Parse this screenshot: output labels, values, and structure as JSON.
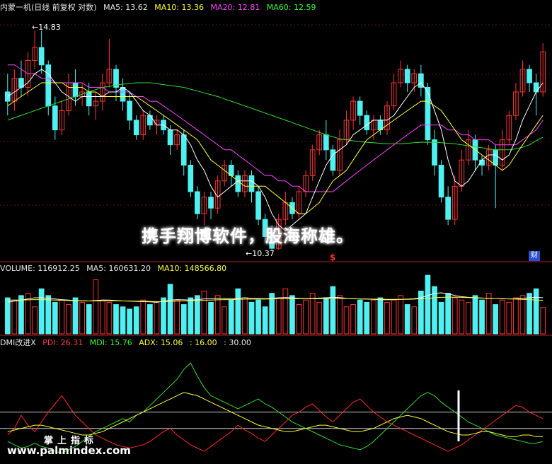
{
  "price_panel": {
    "title": "内蒙一机(日线 前复权 对数)",
    "ma5": "MA5: 13.62",
    "ma10": "MA10: 13.36",
    "ma20": "MA20: 12.81",
    "ma60": "MA60: 12.59",
    "high_label": "←14.83",
    "low_label": "←10.37",
    "slogan": "携手翔博软件，股海称雄。",
    "dollar_mark": "$",
    "cai_badge": "财"
  },
  "volume_panel": {
    "volume": "VOLUME: 116912.25",
    "ma5": "MA5: 160631.20",
    "ma10": "MA10: 148566.80"
  },
  "dmi_panel": {
    "name": "DMI改进X",
    "pdi": "PDI: 26.31",
    "mdi": "MDI: 15.76",
    "adx": "ADX: 15.06",
    "adxr": ": 16.00",
    "level": ": 30.00"
  },
  "watermark": {
    "line1": "掌上指标",
    "line2": "www.palmindex.com"
  },
  "colors": {
    "up": "#ff3333",
    "down": "#4ef0f0",
    "ma5": "#ffffff",
    "ma10": "#ffff33",
    "ma20": "#ff44ff",
    "ma60": "#33dd33"
  },
  "chart_data": {
    "type": "candlestick",
    "scale": "log",
    "ylim": [
      10.2,
      15.2
    ],
    "candles": [
      [
        13.4,
        13.2,
        13.8,
        12.9
      ],
      [
        13.2,
        13.7,
        13.9,
        13.0
      ],
      [
        13.7,
        13.5,
        14.1,
        13.3
      ],
      [
        13.5,
        14.1,
        14.3,
        13.3
      ],
      [
        14.1,
        14.4,
        14.8,
        13.9
      ],
      [
        14.4,
        14.0,
        14.8,
        13.8
      ],
      [
        14.0,
        13.1,
        14.1,
        12.9
      ],
      [
        13.1,
        12.6,
        13.3,
        12.4
      ],
      [
        12.6,
        13.0,
        13.2,
        12.5
      ],
      [
        13.0,
        13.6,
        13.8,
        12.9
      ],
      [
        13.6,
        13.3,
        13.9,
        13.1
      ],
      [
        13.3,
        13.4,
        13.6,
        13.1
      ],
      [
        13.4,
        13.1,
        13.6,
        12.9
      ],
      [
        13.1,
        13.2,
        13.4,
        12.8
      ],
      [
        13.2,
        13.6,
        13.8,
        13.0
      ],
      [
        13.6,
        13.9,
        14.6,
        13.5
      ],
      [
        13.9,
        13.5,
        14.0,
        13.2
      ],
      [
        13.5,
        13.2,
        13.7,
        13.0
      ],
      [
        13.2,
        12.8,
        13.4,
        12.6
      ],
      [
        12.8,
        12.5,
        12.9,
        12.4
      ],
      [
        12.5,
        12.9,
        13.0,
        12.4
      ],
      [
        12.9,
        12.7,
        13.0,
        12.6
      ],
      [
        12.7,
        12.8,
        12.9,
        12.5
      ],
      [
        12.8,
        12.6,
        12.9,
        12.5
      ],
      [
        12.6,
        12.3,
        12.7,
        12.1
      ],
      [
        12.3,
        12.5,
        12.6,
        12.2
      ],
      [
        12.5,
        11.9,
        12.6,
        11.7
      ],
      [
        11.9,
        11.4,
        12.0,
        11.3
      ],
      [
        11.4,
        11.0,
        11.5,
        10.9
      ],
      [
        11.0,
        11.3,
        11.4,
        10.8
      ],
      [
        11.3,
        11.1,
        11.4,
        10.9
      ],
      [
        11.1,
        11.6,
        11.7,
        11.0
      ],
      [
        11.6,
        11.9,
        12.0,
        11.5
      ],
      [
        11.9,
        11.7,
        12.0,
        11.5
      ],
      [
        11.7,
        11.4,
        11.8,
        11.3
      ],
      [
        11.4,
        11.7,
        11.8,
        11.3
      ],
      [
        11.7,
        11.4,
        11.8,
        11.2
      ],
      [
        11.4,
        10.9,
        11.5,
        10.8
      ],
      [
        10.9,
        10.6,
        11.0,
        10.5
      ],
      [
        10.6,
        10.4,
        10.8,
        10.37
      ],
      [
        10.4,
        10.9,
        11.0,
        10.37
      ],
      [
        10.9,
        11.2,
        11.4,
        10.8
      ],
      [
        11.2,
        11.0,
        11.3,
        10.9
      ],
      [
        11.0,
        11.4,
        11.5,
        10.9
      ],
      [
        11.4,
        11.7,
        11.8,
        11.3
      ],
      [
        11.7,
        12.2,
        12.3,
        11.6
      ],
      [
        12.2,
        12.5,
        12.6,
        12.1
      ],
      [
        12.5,
        12.2,
        12.8,
        12.0
      ],
      [
        12.2,
        11.8,
        12.3,
        11.7
      ],
      [
        11.8,
        12.4,
        12.6,
        11.7
      ],
      [
        12.4,
        12.8,
        13.0,
        12.3
      ],
      [
        12.8,
        13.2,
        13.3,
        12.6
      ],
      [
        13.2,
        12.9,
        13.3,
        12.7
      ],
      [
        12.9,
        12.6,
        13.0,
        12.5
      ],
      [
        12.6,
        12.8,
        12.9,
        12.4
      ],
      [
        12.8,
        12.6,
        12.9,
        12.5
      ],
      [
        12.6,
        13.1,
        13.2,
        12.5
      ],
      [
        13.1,
        13.6,
        13.8,
        13.0
      ],
      [
        13.6,
        13.9,
        14.1,
        13.5
      ],
      [
        13.9,
        13.6,
        14.0,
        13.4
      ],
      [
        13.6,
        13.8,
        13.9,
        13.4
      ],
      [
        13.8,
        13.5,
        14.0,
        13.3
      ],
      [
        13.5,
        12.4,
        13.6,
        12.3
      ],
      [
        12.4,
        11.9,
        12.6,
        11.7
      ],
      [
        11.9,
        11.3,
        12.0,
        11.2
      ],
      [
        11.3,
        10.9,
        11.5,
        10.8
      ],
      [
        10.9,
        11.5,
        11.7,
        10.8
      ],
      [
        11.5,
        12.0,
        12.2,
        11.4
      ],
      [
        12.0,
        12.4,
        12.6,
        11.9
      ],
      [
        12.4,
        12.0,
        12.5,
        11.8
      ],
      [
        12.0,
        11.9,
        12.1,
        11.7
      ],
      [
        11.9,
        12.2,
        12.3,
        11.8
      ],
      [
        12.2,
        11.9,
        12.3,
        11.1
      ],
      [
        11.9,
        12.4,
        12.6,
        11.8
      ],
      [
        12.4,
        12.9,
        13.0,
        12.3
      ],
      [
        12.9,
        13.4,
        13.6,
        12.8
      ],
      [
        13.4,
        13.9,
        14.1,
        13.3
      ],
      [
        13.9,
        13.6,
        14.0,
        13.4
      ],
      [
        13.6,
        13.4,
        13.8,
        12.9
      ],
      [
        13.4,
        14.3,
        14.5,
        13.3
      ]
    ],
    "ma5": [
      13.3,
      13.4,
      13.5,
      13.6,
      13.8,
      13.9,
      13.8,
      13.6,
      13.4,
      13.3,
      13.2,
      13.3,
      13.3,
      13.3,
      13.3,
      13.4,
      13.4,
      13.5,
      13.4,
      13.2,
      13.0,
      12.9,
      12.7,
      12.7,
      12.6,
      12.6,
      12.5,
      12.3,
      12.0,
      11.8,
      11.5,
      11.3,
      11.4,
      11.5,
      11.6,
      11.6,
      11.6,
      11.5,
      11.3,
      11.0,
      10.8,
      10.7,
      10.8,
      10.9,
      11.0,
      11.3,
      11.6,
      11.9,
      12.1,
      12.2,
      12.3,
      12.5,
      12.6,
      12.7,
      12.8,
      12.8,
      12.8,
      12.9,
      13.1,
      13.3,
      13.5,
      13.6,
      13.4,
      13.0,
      12.6,
      12.0,
      11.6,
      11.5,
      11.6,
      11.8,
      12.0,
      12.1,
      12.1,
      12.0,
      12.1,
      12.4,
      12.8,
      13.1,
      13.4,
      13.6
    ],
    "ma10": [
      13.1,
      13.2,
      13.3,
      13.4,
      13.5,
      13.6,
      13.6,
      13.6,
      13.6,
      13.5,
      13.5,
      13.5,
      13.4,
      13.4,
      13.3,
      13.3,
      13.3,
      13.3,
      13.3,
      13.3,
      13.2,
      13.1,
      13.0,
      12.9,
      12.8,
      12.7,
      12.6,
      12.5,
      12.4,
      12.2,
      12.0,
      11.9,
      11.8,
      11.7,
      11.6,
      11.5,
      11.5,
      11.5,
      11.5,
      11.4,
      11.3,
      11.2,
      11.1,
      11.0,
      11.0,
      11.1,
      11.2,
      11.4,
      11.6,
      11.7,
      11.8,
      12.0,
      12.2,
      12.4,
      12.5,
      12.6,
      12.7,
      12.8,
      12.9,
      13.0,
      13.1,
      13.2,
      13.2,
      13.1,
      13.0,
      12.8,
      12.6,
      12.4,
      12.3,
      12.2,
      12.1,
      12.0,
      11.9,
      11.8,
      11.9,
      12.1,
      12.3,
      12.5,
      12.7,
      12.9
    ],
    "ma20": [
      14.0,
      14.0,
      13.9,
      13.8,
      13.8,
      13.7,
      13.7,
      13.6,
      13.6,
      13.6,
      13.6,
      13.6,
      13.5,
      13.5,
      13.5,
      13.4,
      13.4,
      13.4,
      13.4,
      13.3,
      13.3,
      13.2,
      13.2,
      13.1,
      13.0,
      12.9,
      12.8,
      12.7,
      12.6,
      12.5,
      12.4,
      12.3,
      12.2,
      12.2,
      12.1,
      12.0,
      11.9,
      11.8,
      11.7,
      11.7,
      11.6,
      11.6,
      11.5,
      11.5,
      11.4,
      11.4,
      11.4,
      11.4,
      11.4,
      11.5,
      11.6,
      11.7,
      11.8,
      11.9,
      12.0,
      12.1,
      12.2,
      12.3,
      12.4,
      12.5,
      12.6,
      12.7,
      12.7,
      12.7,
      12.7,
      12.6,
      12.6,
      12.5,
      12.5,
      12.4,
      12.4,
      12.4,
      12.3,
      12.3,
      12.3,
      12.3,
      12.4,
      12.5,
      12.6,
      12.8
    ],
    "ma60": [
      12.8,
      12.85,
      12.9,
      12.95,
      13.0,
      13.05,
      13.1,
      13.15,
      13.2,
      13.25,
      13.3,
      13.35,
      13.4,
      13.45,
      13.5,
      13.52,
      13.55,
      13.57,
      13.58,
      13.6,
      13.6,
      13.6,
      13.58,
      13.56,
      13.54,
      13.52,
      13.5,
      13.46,
      13.42,
      13.38,
      13.34,
      13.3,
      13.25,
      13.2,
      13.15,
      13.1,
      13.05,
      13.0,
      12.95,
      12.9,
      12.85,
      12.8,
      12.75,
      12.7,
      12.65,
      12.6,
      12.55,
      12.5,
      12.46,
      12.42,
      12.4,
      12.38,
      12.36,
      12.35,
      12.34,
      12.33,
      12.32,
      12.32,
      12.32,
      12.33,
      12.34,
      12.35,
      12.35,
      12.35,
      12.34,
      12.33,
      12.32,
      12.3,
      12.28,
      12.26,
      12.24,
      12.22,
      12.2,
      12.2,
      12.2,
      12.22,
      12.25,
      12.3,
      12.38,
      12.45
    ],
    "volume": [
      160,
      150,
      170,
      180,
      120,
      200,
      170,
      140,
      150,
      130,
      160,
      140,
      130,
      240,
      150,
      140,
      130,
      120,
      110,
      120,
      150,
      130,
      140,
      160,
      220,
      150,
      130,
      160,
      170,
      190,
      140,
      170,
      120,
      150,
      200,
      160,
      140,
      150,
      120,
      180,
      160,
      200,
      170,
      130,
      150,
      180,
      140,
      160,
      210,
      170,
      120,
      130,
      150,
      140,
      150,
      160,
      140,
      150,
      170,
      130,
      120,
      190,
      260,
      210,
      140,
      180,
      160,
      150,
      140,
      170,
      150,
      180,
      130,
      150,
      140,
      160,
      170,
      180,
      200,
      117
    ],
    "vol_ma5": [
      140,
      145,
      150,
      155,
      160,
      160,
      158,
      155,
      152,
      150,
      148,
      147,
      146,
      148,
      150,
      150,
      148,
      146,
      145,
      144,
      143,
      142,
      140,
      145,
      150,
      152,
      151,
      150,
      152,
      155,
      156,
      158,
      157,
      156,
      158,
      160,
      158,
      157,
      156,
      158,
      160,
      161,
      160,
      158,
      157,
      158,
      159,
      160,
      162,
      161,
      158,
      156,
      155,
      154,
      153,
      152,
      151,
      152,
      153,
      154,
      156,
      160,
      170,
      180,
      182,
      178,
      170,
      165,
      162,
      160,
      159,
      158,
      157,
      156,
      155,
      156,
      158,
      160,
      162,
      160
    ],
    "vol_ma10": [
      150,
      150,
      150,
      151,
      152,
      152,
      151,
      150,
      149,
      148,
      147,
      147,
      146,
      146,
      147,
      147,
      147,
      146,
      146,
      145,
      145,
      144,
      143,
      143,
      144,
      145,
      146,
      147,
      148,
      149,
      150,
      151,
      152,
      152,
      153,
      154,
      154,
      154,
      154,
      155,
      156,
      156,
      156,
      156,
      156,
      156,
      156,
      157,
      157,
      157,
      157,
      156,
      155,
      155,
      154,
      154,
      153,
      153,
      153,
      153,
      154,
      156,
      158,
      160,
      162,
      163,
      163,
      162,
      161,
      160,
      159,
      158,
      157,
      156,
      155,
      154,
      153,
      152,
      150,
      149
    ],
    "pdi": [
      16,
      20,
      28,
      22,
      18,
      24,
      30,
      35,
      40,
      34,
      28,
      24,
      20,
      16,
      14,
      12,
      10,
      9,
      8,
      9,
      10,
      12,
      15,
      18,
      20,
      16,
      13,
      10,
      8,
      6,
      9,
      12,
      15,
      18,
      22,
      19,
      17,
      14,
      12,
      16,
      20,
      24,
      28,
      30,
      33,
      35,
      31,
      27,
      24,
      28,
      32,
      36,
      38,
      34,
      30,
      27,
      24,
      22,
      20,
      18,
      16,
      14,
      12,
      10,
      8,
      6,
      8,
      10,
      13,
      16,
      19,
      22,
      25,
      28,
      31,
      34,
      33,
      30,
      28,
      26
    ],
    "mdi": [
      12,
      10,
      8,
      9,
      11,
      9,
      8,
      6,
      5,
      7,
      9,
      12,
      15,
      18,
      20,
      22,
      24,
      26,
      24,
      28,
      30,
      34,
      38,
      42,
      46,
      50,
      56,
      60,
      52,
      45,
      40,
      38,
      36,
      34,
      32,
      34,
      36,
      38,
      35,
      33,
      30,
      27,
      24,
      22,
      20,
      18,
      16,
      14,
      12,
      10,
      9,
      8,
      7,
      9,
      12,
      16,
      20,
      24,
      28,
      32,
      36,
      40,
      42,
      40,
      36,
      33,
      30,
      27,
      24,
      22,
      20,
      18,
      16,
      15,
      14,
      13,
      12,
      11,
      11,
      12
    ],
    "adx": [
      18,
      19,
      20,
      21,
      22,
      22,
      21,
      20,
      19,
      18,
      17,
      16,
      16,
      17,
      18,
      20,
      22,
      24,
      26,
      28,
      30,
      32,
      34,
      36,
      38,
      40,
      42,
      41,
      40,
      38,
      36,
      34,
      32,
      30,
      28,
      26,
      24,
      22,
      21,
      20,
      19,
      18,
      18,
      19,
      20,
      21,
      22,
      22,
      21,
      20,
      19,
      18,
      18,
      19,
      20,
      22,
      24,
      26,
      27,
      28,
      27,
      26,
      24,
      22,
      20,
      18,
      17,
      16,
      16,
      17,
      18,
      18,
      17,
      16,
      15,
      15,
      16,
      16,
      15,
      15
    ],
    "dmi_levels": [
      20,
      30
    ]
  }
}
